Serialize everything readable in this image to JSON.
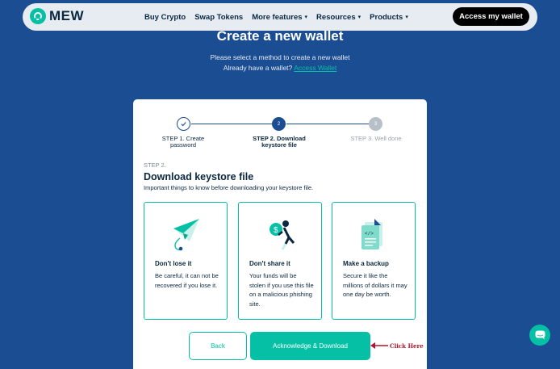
{
  "header": {
    "logo_text": "MEW",
    "nav": [
      {
        "label": "Buy Crypto",
        "has_menu": false
      },
      {
        "label": "Swap Tokens",
        "has_menu": false
      },
      {
        "label": "More features",
        "has_menu": true
      },
      {
        "label": "Resources",
        "has_menu": true
      },
      {
        "label": "Products",
        "has_menu": true
      }
    ],
    "access_button": "Access my wallet"
  },
  "page": {
    "title": "Create a new wallet",
    "subtitle": "Please select a method to create a new wallet",
    "already_text": "Already have a wallet?",
    "access_link": "Access Wallet"
  },
  "stepper": {
    "steps": [
      {
        "number": "✓",
        "label_line1": "STEP 1. Create",
        "label_line2": "password",
        "state": "done"
      },
      {
        "number": "2",
        "label_line1": "STEP 2. Download",
        "label_line2": "keystore file",
        "state": "active"
      },
      {
        "number": "3",
        "label_line1": "STEP 3. Well done",
        "label_line2": "",
        "state": "upcoming"
      }
    ]
  },
  "card": {
    "kicker": "STEP 2.",
    "title": "Download keystore file",
    "description": "Important things to know before downloading your keystore file.",
    "tiles": [
      {
        "icon": "paper-plane-icon",
        "title": "Don't lose it",
        "text": "Be careful, it can not be recovered if you lose it."
      },
      {
        "icon": "thief-icon",
        "title": "Don't share it",
        "text": "Your funds will be stolen if you use this file on a malicious phishing site."
      },
      {
        "icon": "document-backup-icon",
        "title": "Make a backup",
        "text": "Secure it like the millions of dollars it may one day be worth."
      }
    ],
    "back_label": "Back",
    "ack_label": "Acknowledge & Download"
  },
  "annotation": {
    "text": "Click Here"
  },
  "colors": {
    "brand_teal": "#05c0a5",
    "background": "#1a4d91",
    "annotation_red": "#b3142a"
  }
}
